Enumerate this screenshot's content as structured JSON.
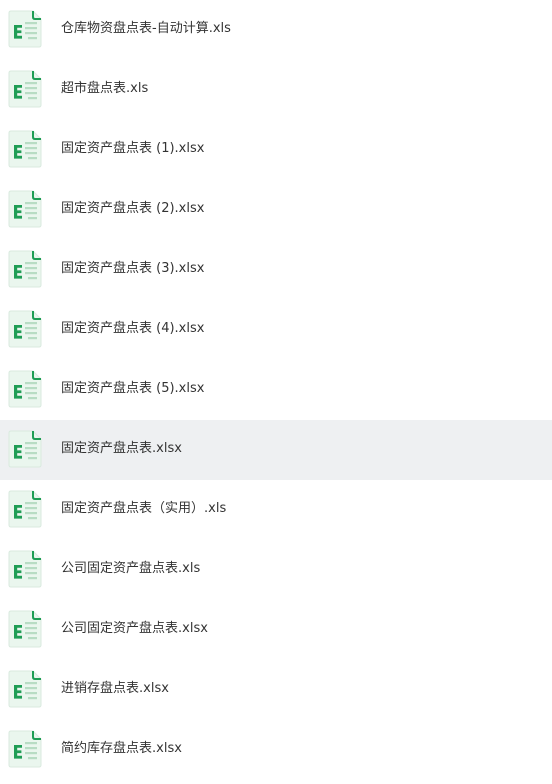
{
  "colors": {
    "icon_green": "#1f9d55",
    "icon_bg": "#eaf6ee",
    "selected_row_bg": "#eef0f2",
    "text": "#333333"
  },
  "file_icon": "excel-spreadsheet-icon",
  "files": [
    {
      "name": "仓库物资盘点表-自动计算.xls",
      "selected": false
    },
    {
      "name": "超市盘点表.xls",
      "selected": false
    },
    {
      "name": "固定资产盘点表 (1).xlsx",
      "selected": false
    },
    {
      "name": "固定资产盘点表 (2).xlsx",
      "selected": false
    },
    {
      "name": "固定资产盘点表 (3).xlsx",
      "selected": false
    },
    {
      "name": "固定资产盘点表 (4).xlsx",
      "selected": false
    },
    {
      "name": "固定资产盘点表 (5).xlsx",
      "selected": false
    },
    {
      "name": "固定资产盘点表.xlsx",
      "selected": true
    },
    {
      "name": "固定资产盘点表（实用）.xls",
      "selected": false
    },
    {
      "name": "公司固定资产盘点表.xls",
      "selected": false
    },
    {
      "name": "公司固定资产盘点表.xlsx",
      "selected": false
    },
    {
      "name": "进销存盘点表.xlsx",
      "selected": false
    },
    {
      "name": "简约库存盘点表.xlsx",
      "selected": false
    }
  ]
}
